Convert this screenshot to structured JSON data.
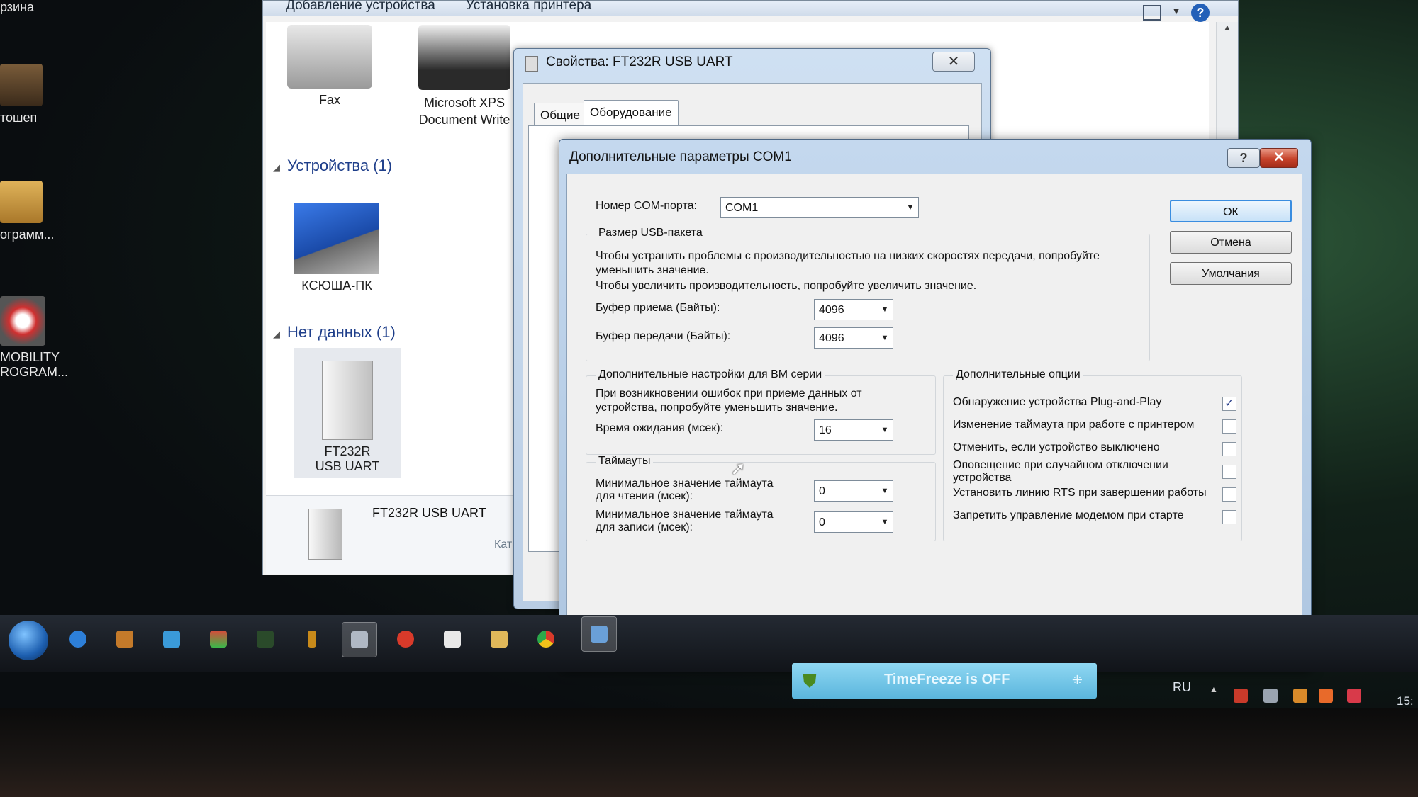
{
  "desktop": {
    "icons": [
      {
        "label": "рзина"
      },
      {
        "label": "тошеп"
      },
      {
        "label": "ограмм..."
      },
      {
        "label": "MOBILITY\nROGRAM..."
      }
    ]
  },
  "devices_window": {
    "toolbar": {
      "add_device": "Добавление устройства",
      "add_printer": "Установка принтера"
    },
    "printers": [
      {
        "label": "Fax"
      },
      {
        "label": "Microsoft XPS Document Write"
      }
    ],
    "groups": [
      {
        "label": "Устройства (1)"
      },
      {
        "label": "Нет данных (1)"
      }
    ],
    "devices": [
      {
        "label": "КСЮША-ПК"
      },
      {
        "label": "FT232R USB UART"
      }
    ],
    "details": {
      "name": "FT232R USB UART",
      "category_partial": "Кат"
    }
  },
  "props_window": {
    "title": "Свойства: FT232R USB UART",
    "close_glyph": "✕",
    "tabs": [
      {
        "label": "Общие",
        "active": false
      },
      {
        "label": "Оборудование",
        "active": true
      }
    ]
  },
  "adv_dialog": {
    "title": "Дополнительные параметры COM1",
    "help_glyph": "?",
    "close_glyph": "✕",
    "com_port_label": "Номер COM-порта:",
    "com_port_value": "COM1",
    "usb_group": {
      "title": "Размер USB-пакета",
      "text1": "Чтобы устранить проблемы с производительностью на низких скоростях передачи, попробуйте уменьшить значение.",
      "text2": "Чтобы увеличить производительность, попробуйте увеличить значение.",
      "rx_label": "Буфер приема (Байты):",
      "rx_value": "4096",
      "tx_label": "Буфер передачи (Байты):",
      "tx_value": "4096"
    },
    "bm_group": {
      "title": "Дополнительные настройки для BM серии",
      "text": "При возникновении ошибок при приеме данных от устройства, попробуйте уменьшить значение.",
      "latency_label": "Время ожидания (мсек):",
      "latency_value": "16"
    },
    "timeouts_group": {
      "title": "Таймауты",
      "read_label": "Минимальное значение таймаута для чтения (мсек):",
      "read_value": "0",
      "write_label": "Минимальное значение таймаута для записи (мсек):",
      "write_value": "0"
    },
    "options_group": {
      "title": "Дополнительные опции",
      "items": [
        {
          "label": "Обнаружение устройства Plug-and-Play",
          "checked": true
        },
        {
          "label": "Изменение таймаута при работе с принтером",
          "checked": false
        },
        {
          "label": "Отменить, если устройство выключено",
          "checked": false
        },
        {
          "label": "Оповещение при случайном отключении устройства",
          "checked": false
        },
        {
          "label": "Установить линию RTS при завершении работы",
          "checked": false
        },
        {
          "label": "Запретить управление модемом при старте",
          "checked": false
        }
      ]
    },
    "buttons": {
      "ok": "ОК",
      "cancel": "Отмена",
      "defaults": "Умолчания"
    }
  },
  "taskbar": {
    "timefreeze_text": "TimeFreeze is OFF",
    "language": "RU",
    "clock_partial": "15:"
  },
  "colors": {
    "accent": "#3a8de0",
    "close_red": "#c6422a",
    "link_blue": "#1e3e8a"
  }
}
